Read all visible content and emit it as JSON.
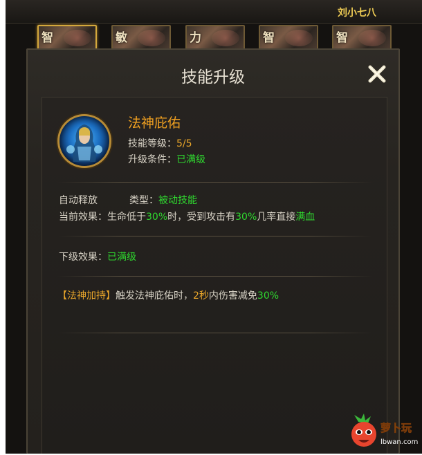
{
  "player_name": "刘小七八",
  "portraits": [
    {
      "attr": "智",
      "selected": true
    },
    {
      "attr": "敏",
      "selected": false
    },
    {
      "attr": "力",
      "selected": false
    },
    {
      "attr": "智",
      "selected": false
    },
    {
      "attr": "智",
      "selected": false
    }
  ],
  "dialog": {
    "title": "技能升级",
    "close_icon": "close-x-icon"
  },
  "skill": {
    "name": "法神庇佑",
    "level_label": "技能等级：",
    "level_value": "5/5",
    "condition_label": "升级条件：",
    "condition_value": "已满级"
  },
  "details": {
    "auto_release": "自动释放",
    "type_label": "类型：",
    "type_value": "被动技能",
    "current_label": "当前效果：",
    "current_p1": "生命低于",
    "current_v1": "30%",
    "current_p2": "时，受到攻击有",
    "current_v2": "30%",
    "current_p3": "几率直接",
    "current_v3": "满血",
    "next_label": "下级效果：",
    "next_value": "已满级",
    "bonus_tag": "【法神加持】",
    "bonus_p1": "触发法神庇佑时，",
    "bonus_v1": "2秒",
    "bonus_p2": "内伤害减免",
    "bonus_v2": "30%"
  },
  "watermark": {
    "brand": "萝卜玩",
    "url": "lbwan.com"
  },
  "colors": {
    "accent_orange": "#f0a020",
    "value_green": "#2fd82f",
    "gold": "#e9a62a"
  }
}
